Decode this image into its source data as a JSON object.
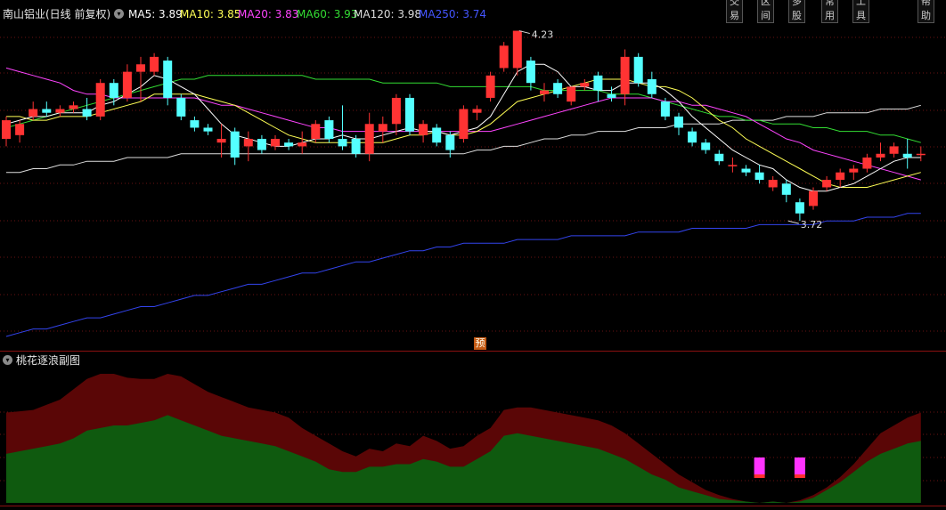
{
  "header": {
    "stock_title": "南山铝业(日线 前复权)",
    "ma_items": [
      {
        "label": "MA5: 3.89",
        "color": "#ffffff"
      },
      {
        "label": "MA10: 3.85",
        "color": "#ffff55"
      },
      {
        "label": "MA20: 3.83",
        "color": "#ff44ff"
      },
      {
        "label": "MA60: 3.93",
        "color": "#33dd33"
      },
      {
        "label": "MA120: 3.98",
        "color": "#dddddd"
      },
      {
        "label": "MA250: 3.74",
        "color": "#4455ff"
      }
    ]
  },
  "sub_chart": {
    "title": "桃花逐浪副图"
  },
  "top_menu": {
    "right_items": [
      "交易",
      "区间",
      "多股",
      "常用",
      "工具",
      "帮助"
    ]
  },
  "annotations": {
    "high": "4.23",
    "low": "3.72",
    "pre_marker": "预"
  },
  "icons": {
    "collapse": "chevron-down-icon"
  },
  "colors": {
    "up": "#ff3333",
    "down": "#54ffff",
    "ma5": "#ffffff",
    "ma10": "#ffff55",
    "ma20": "#ff44ff",
    "ma60": "#33dd33",
    "ma120": "#dddddd",
    "ma250": "#3344ee"
  },
  "chart_data": {
    "type": "candlestick",
    "candles": [
      {
        "o": 3.94,
        "c": 3.99,
        "h": 4.0,
        "l": 3.92
      },
      {
        "o": 3.95,
        "c": 3.98,
        "h": 3.99,
        "l": 3.93
      },
      {
        "o": 4.0,
        "c": 4.02,
        "h": 4.04,
        "l": 3.99
      },
      {
        "o": 4.02,
        "c": 4.01,
        "h": 4.04,
        "l": 4.0
      },
      {
        "o": 4.01,
        "c": 4.02,
        "h": 4.03,
        "l": 4.0
      },
      {
        "o": 4.02,
        "c": 4.03,
        "h": 4.04,
        "l": 4.01
      },
      {
        "o": 4.02,
        "c": 4.0,
        "h": 4.05,
        "l": 3.99
      },
      {
        "o": 4.0,
        "c": 4.09,
        "h": 4.1,
        "l": 3.99
      },
      {
        "o": 4.09,
        "c": 4.05,
        "h": 4.1,
        "l": 4.03
      },
      {
        "o": 4.05,
        "c": 4.12,
        "h": 4.14,
        "l": 4.04
      },
      {
        "o": 4.12,
        "c": 4.14,
        "h": 4.16,
        "l": 4.04
      },
      {
        "o": 4.12,
        "c": 4.16,
        "h": 4.17,
        "l": 4.11
      },
      {
        "o": 4.15,
        "c": 4.05,
        "h": 4.16,
        "l": 4.03
      },
      {
        "o": 4.05,
        "c": 4.0,
        "h": 4.06,
        "l": 3.99
      },
      {
        "o": 3.99,
        "c": 3.97,
        "h": 4.0,
        "l": 3.96
      },
      {
        "o": 3.97,
        "c": 3.96,
        "h": 3.98,
        "l": 3.95
      },
      {
        "o": 3.93,
        "c": 3.94,
        "h": 3.98,
        "l": 3.89
      },
      {
        "o": 3.96,
        "c": 3.89,
        "h": 3.97,
        "l": 3.87
      },
      {
        "o": 3.92,
        "c": 3.94,
        "h": 3.96,
        "l": 3.88
      },
      {
        "o": 3.94,
        "c": 3.91,
        "h": 3.95,
        "l": 3.9
      },
      {
        "o": 3.92,
        "c": 3.94,
        "h": 3.95,
        "l": 3.91
      },
      {
        "o": 3.93,
        "c": 3.92,
        "h": 3.94,
        "l": 3.91
      },
      {
        "o": 3.92,
        "c": 3.93,
        "h": 3.96,
        "l": 3.9
      },
      {
        "o": 3.94,
        "c": 3.98,
        "h": 3.99,
        "l": 3.93
      },
      {
        "o": 3.99,
        "c": 3.94,
        "h": 4.0,
        "l": 3.93
      },
      {
        "o": 3.94,
        "c": 3.92,
        "h": 4.03,
        "l": 3.91
      },
      {
        "o": 3.94,
        "c": 3.9,
        "h": 3.95,
        "l": 3.89
      },
      {
        "o": 3.9,
        "c": 3.98,
        "h": 4.01,
        "l": 3.88
      },
      {
        "o": 3.96,
        "c": 3.98,
        "h": 4.0,
        "l": 3.93
      },
      {
        "o": 3.98,
        "c": 4.05,
        "h": 4.06,
        "l": 3.95
      },
      {
        "o": 4.05,
        "c": 3.96,
        "h": 4.06,
        "l": 3.95
      },
      {
        "o": 3.95,
        "c": 3.98,
        "h": 3.99,
        "l": 3.93
      },
      {
        "o": 3.97,
        "c": 3.93,
        "h": 3.98,
        "l": 3.92
      },
      {
        "o": 3.95,
        "c": 3.91,
        "h": 3.96,
        "l": 3.89
      },
      {
        "o": 3.94,
        "c": 4.02,
        "h": 4.03,
        "l": 3.93
      },
      {
        "o": 4.01,
        "c": 4.02,
        "h": 4.03,
        "l": 3.99
      },
      {
        "o": 4.05,
        "c": 4.11,
        "h": 4.12,
        "l": 4.04
      },
      {
        "o": 4.13,
        "c": 4.19,
        "h": 4.2,
        "l": 4.12
      },
      {
        "o": 4.13,
        "c": 4.23,
        "h": 4.23,
        "l": 4.11
      },
      {
        "o": 4.15,
        "c": 4.09,
        "h": 4.16,
        "l": 4.07
      },
      {
        "o": 4.06,
        "c": 4.07,
        "h": 4.09,
        "l": 4.04
      },
      {
        "o": 4.09,
        "c": 4.06,
        "h": 4.1,
        "l": 4.05
      },
      {
        "o": 4.04,
        "c": 4.08,
        "h": 4.08,
        "l": 4.03
      },
      {
        "o": 4.08,
        "c": 4.09,
        "h": 4.1,
        "l": 4.07
      },
      {
        "o": 4.11,
        "c": 4.07,
        "h": 4.12,
        "l": 4.04
      },
      {
        "o": 4.06,
        "c": 4.05,
        "h": 4.08,
        "l": 4.04
      },
      {
        "o": 4.06,
        "c": 4.16,
        "h": 4.18,
        "l": 4.03
      },
      {
        "o": 4.16,
        "c": 4.09,
        "h": 4.17,
        "l": 4.08
      },
      {
        "o": 4.1,
        "c": 4.06,
        "h": 4.12,
        "l": 4.05
      },
      {
        "o": 4.04,
        "c": 4.0,
        "h": 4.05,
        "l": 3.99
      },
      {
        "o": 4.0,
        "c": 3.97,
        "h": 4.01,
        "l": 3.95
      },
      {
        "o": 3.96,
        "c": 3.93,
        "h": 3.97,
        "l": 3.92
      },
      {
        "o": 3.93,
        "c": 3.91,
        "h": 3.94,
        "l": 3.9
      },
      {
        "o": 3.9,
        "c": 3.88,
        "h": 3.91,
        "l": 3.87
      },
      {
        "o": 3.87,
        "c": 3.87,
        "h": 3.89,
        "l": 3.85
      },
      {
        "o": 3.86,
        "c": 3.85,
        "h": 3.87,
        "l": 3.84
      },
      {
        "o": 3.85,
        "c": 3.83,
        "h": 3.87,
        "l": 3.82
      },
      {
        "o": 3.81,
        "c": 3.83,
        "h": 3.84,
        "l": 3.8
      },
      {
        "o": 3.82,
        "c": 3.79,
        "h": 3.83,
        "l": 3.77
      },
      {
        "o": 3.77,
        "c": 3.74,
        "h": 3.78,
        "l": 3.72
      },
      {
        "o": 3.76,
        "c": 3.8,
        "h": 3.81,
        "l": 3.75
      },
      {
        "o": 3.81,
        "c": 3.83,
        "h": 3.84,
        "l": 3.8
      },
      {
        "o": 3.83,
        "c": 3.85,
        "h": 3.86,
        "l": 3.81
      },
      {
        "o": 3.85,
        "c": 3.86,
        "h": 3.87,
        "l": 3.83
      },
      {
        "o": 3.86,
        "c": 3.89,
        "h": 3.9,
        "l": 3.85
      },
      {
        "o": 3.89,
        "c": 3.9,
        "h": 3.93,
        "l": 3.88
      },
      {
        "o": 3.9,
        "c": 3.92,
        "h": 3.93,
        "l": 3.89
      },
      {
        "o": 3.9,
        "c": 3.89,
        "h": 3.94,
        "l": 3.86
      },
      {
        "o": 3.9,
        "c": 3.9,
        "h": 3.92,
        "l": 3.88
      }
    ],
    "ma5": [
      3.98,
      3.99,
      4.0,
      4.0,
      4.01,
      4.01,
      4.01,
      4.03,
      4.04,
      4.06,
      4.08,
      4.11,
      4.1,
      4.08,
      4.06,
      4.02,
      3.98,
      3.95,
      3.94,
      3.93,
      3.92,
      3.92,
      3.93,
      3.94,
      3.94,
      3.95,
      3.94,
      3.94,
      3.95,
      3.96,
      3.97,
      3.96,
      3.96,
      3.95,
      3.96,
      3.97,
      4.0,
      4.06,
      4.12,
      4.14,
      4.14,
      4.12,
      4.08,
      4.08,
      4.07,
      4.07,
      4.09,
      4.09,
      4.09,
      4.07,
      4.04,
      4.0,
      3.97,
      3.94,
      3.91,
      3.89,
      3.87,
      3.86,
      3.83,
      3.81,
      3.8,
      3.8,
      3.81,
      3.82,
      3.84,
      3.86,
      3.88,
      3.89,
      3.89
    ],
    "ma10": [
      4.0,
      4.0,
      3.99,
      3.99,
      4.0,
      4.0,
      4.0,
      4.01,
      4.02,
      4.03,
      4.04,
      4.06,
      4.06,
      4.06,
      4.06,
      4.05,
      4.04,
      4.03,
      4.01,
      3.99,
      3.97,
      3.95,
      3.94,
      3.93,
      3.93,
      3.93,
      3.93,
      3.93,
      3.93,
      3.94,
      3.95,
      3.95,
      3.96,
      3.95,
      3.95,
      3.96,
      3.98,
      4.01,
      4.04,
      4.05,
      4.06,
      4.07,
      4.08,
      4.09,
      4.1,
      4.1,
      4.1,
      4.09,
      4.08,
      4.08,
      4.07,
      4.05,
      4.02,
      3.99,
      3.97,
      3.94,
      3.92,
      3.9,
      3.88,
      3.86,
      3.84,
      3.82,
      3.81,
      3.81,
      3.81,
      3.82,
      3.83,
      3.84,
      3.85
    ],
    "ma20": [
      4.13,
      4.12,
      4.11,
      4.1,
      4.09,
      4.07,
      4.06,
      4.06,
      4.05,
      4.05,
      4.05,
      4.05,
      4.05,
      4.05,
      4.05,
      4.04,
      4.03,
      4.03,
      4.02,
      4.01,
      4.0,
      3.99,
      3.98,
      3.97,
      3.97,
      3.96,
      3.96,
      3.96,
      3.96,
      3.96,
      3.96,
      3.96,
      3.96,
      3.96,
      3.96,
      3.96,
      3.96,
      3.97,
      3.98,
      3.99,
      4.0,
      4.01,
      4.02,
      4.03,
      4.04,
      4.05,
      4.05,
      4.05,
      4.05,
      4.04,
      4.04,
      4.03,
      4.03,
      4.02,
      4.01,
      4.0,
      3.98,
      3.96,
      3.94,
      3.93,
      3.91,
      3.9,
      3.89,
      3.88,
      3.87,
      3.86,
      3.85,
      3.84,
      3.83
    ],
    "ma60": [
      3.97,
      3.98,
      3.99,
      4.0,
      4.01,
      4.02,
      4.03,
      4.04,
      4.05,
      4.06,
      4.07,
      4.08,
      4.09,
      4.1,
      4.1,
      4.11,
      4.11,
      4.11,
      4.11,
      4.11,
      4.11,
      4.11,
      4.11,
      4.1,
      4.1,
      4.1,
      4.1,
      4.1,
      4.09,
      4.09,
      4.09,
      4.09,
      4.09,
      4.08,
      4.08,
      4.08,
      4.08,
      4.08,
      4.08,
      4.08,
      4.07,
      4.07,
      4.07,
      4.07,
      4.07,
      4.06,
      4.06,
      4.06,
      4.05,
      4.04,
      4.03,
      4.02,
      4.01,
      4.0,
      4.0,
      3.99,
      3.99,
      3.98,
      3.98,
      3.98,
      3.97,
      3.97,
      3.96,
      3.96,
      3.96,
      3.95,
      3.95,
      3.94,
      3.93
    ],
    "ma120": [
      3.85,
      3.85,
      3.86,
      3.86,
      3.87,
      3.87,
      3.88,
      3.88,
      3.88,
      3.89,
      3.89,
      3.89,
      3.89,
      3.9,
      3.9,
      3.9,
      3.9,
      3.9,
      3.9,
      3.9,
      3.9,
      3.9,
      3.9,
      3.9,
      3.9,
      3.9,
      3.9,
      3.9,
      3.9,
      3.9,
      3.9,
      3.9,
      3.9,
      3.9,
      3.9,
      3.91,
      3.91,
      3.92,
      3.92,
      3.93,
      3.94,
      3.94,
      3.95,
      3.95,
      3.96,
      3.96,
      3.96,
      3.97,
      3.97,
      3.97,
      3.98,
      3.98,
      3.98,
      3.98,
      3.99,
      3.99,
      3.99,
      3.99,
      4.0,
      4.0,
      4.0,
      4.01,
      4.01,
      4.01,
      4.01,
      4.02,
      4.02,
      4.02,
      4.03
    ],
    "ma250": [
      3.41,
      3.42,
      3.43,
      3.43,
      3.44,
      3.45,
      3.46,
      3.46,
      3.47,
      3.48,
      3.49,
      3.49,
      3.5,
      3.51,
      3.52,
      3.52,
      3.53,
      3.54,
      3.55,
      3.55,
      3.56,
      3.57,
      3.58,
      3.58,
      3.59,
      3.6,
      3.61,
      3.61,
      3.62,
      3.63,
      3.64,
      3.64,
      3.65,
      3.65,
      3.66,
      3.66,
      3.66,
      3.66,
      3.67,
      3.67,
      3.67,
      3.67,
      3.68,
      3.68,
      3.68,
      3.68,
      3.68,
      3.69,
      3.69,
      3.69,
      3.69,
      3.7,
      3.7,
      3.7,
      3.7,
      3.7,
      3.71,
      3.71,
      3.71,
      3.71,
      3.71,
      3.72,
      3.72,
      3.72,
      3.73,
      3.73,
      3.73,
      3.74,
      3.74
    ],
    "sub_upper": [
      0.7,
      0.71,
      0.72,
      0.76,
      0.8,
      0.88,
      0.96,
      1.0,
      1.0,
      0.97,
      0.96,
      0.96,
      1.0,
      0.98,
      0.92,
      0.86,
      0.82,
      0.78,
      0.74,
      0.72,
      0.7,
      0.66,
      0.58,
      0.52,
      0.46,
      0.4,
      0.36,
      0.42,
      0.4,
      0.46,
      0.44,
      0.52,
      0.48,
      0.42,
      0.44,
      0.52,
      0.58,
      0.72,
      0.74,
      0.74,
      0.72,
      0.7,
      0.68,
      0.66,
      0.64,
      0.6,
      0.54,
      0.46,
      0.38,
      0.3,
      0.22,
      0.16,
      0.1,
      0.06,
      0.03,
      0.01,
      0.0,
      0.01,
      0.0,
      0.02,
      0.06,
      0.12,
      0.2,
      0.3,
      0.42,
      0.54,
      0.6,
      0.66,
      0.7
    ],
    "sub_lower": [
      0.38,
      0.4,
      0.42,
      0.44,
      0.46,
      0.5,
      0.56,
      0.58,
      0.6,
      0.6,
      0.62,
      0.64,
      0.68,
      0.64,
      0.6,
      0.56,
      0.52,
      0.5,
      0.48,
      0.46,
      0.44,
      0.4,
      0.36,
      0.32,
      0.26,
      0.24,
      0.24,
      0.28,
      0.28,
      0.3,
      0.3,
      0.34,
      0.32,
      0.28,
      0.28,
      0.34,
      0.4,
      0.52,
      0.54,
      0.52,
      0.5,
      0.48,
      0.46,
      0.44,
      0.42,
      0.38,
      0.34,
      0.28,
      0.22,
      0.18,
      0.12,
      0.09,
      0.06,
      0.03,
      0.02,
      0.01,
      0.0,
      0.01,
      0.0,
      0.01,
      0.04,
      0.1,
      0.16,
      0.24,
      0.32,
      0.38,
      0.42,
      0.46,
      0.48
    ],
    "sub_signals": [
      56,
      59
    ]
  }
}
